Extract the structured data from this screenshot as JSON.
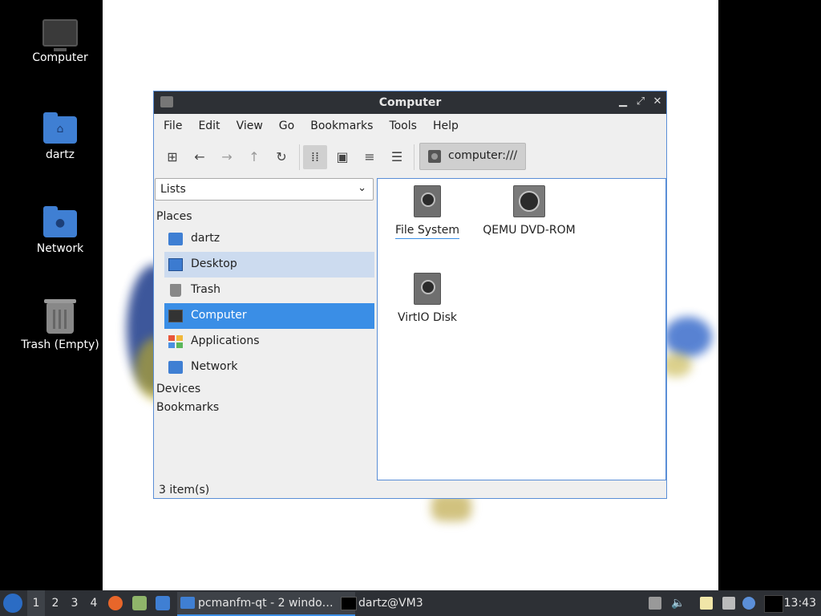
{
  "desktop": {
    "icons": [
      {
        "label": "Computer",
        "icon": "monitor-icon"
      },
      {
        "label": "dartz",
        "icon": "home-folder-icon"
      },
      {
        "label": "Network",
        "icon": "network-folder-icon"
      },
      {
        "label": "Trash (Empty)",
        "icon": "trash-icon"
      }
    ]
  },
  "window": {
    "title": "Computer",
    "menu": [
      "File",
      "Edit",
      "View",
      "Go",
      "Bookmarks",
      "Tools",
      "Help"
    ],
    "toolbar": {
      "buttons": [
        "new-tab-icon",
        "back-arrow-icon",
        "forward-arrow-icon",
        "up-arrow-icon",
        "reload-icon",
        "icon-view-icon",
        "thumbnail-view-icon",
        "compact-view-icon",
        "detailed-list-icon"
      ],
      "path": "computer:///"
    },
    "side": {
      "mode": "Lists",
      "places_label": "Places",
      "places": [
        {
          "label": "dartz",
          "icon": "home-folder-icon"
        },
        {
          "label": "Desktop",
          "icon": "desktop-icon"
        },
        {
          "label": "Trash",
          "icon": "trash-icon"
        },
        {
          "label": "Computer",
          "icon": "computer-icon"
        },
        {
          "label": "Applications",
          "icon": "applications-icon"
        },
        {
          "label": "Network",
          "icon": "network-folder-icon"
        }
      ],
      "devices_label": "Devices",
      "bookmarks_label": "Bookmarks"
    },
    "items": [
      {
        "label": "File System",
        "icon": "hard-disk-icon"
      },
      {
        "label": "QEMU DVD-ROM",
        "icon": "optical-drive-icon"
      },
      {
        "label": "VirtIO Disk",
        "icon": "hard-disk-icon"
      }
    ],
    "status": "3 item(s)"
  },
  "taskbar": {
    "workspaces": [
      "1",
      "2",
      "3",
      "4"
    ],
    "tasks": [
      {
        "label": "pcmanfm-qt - 2 windo…"
      },
      {
        "label": "dartz@VM3"
      }
    ],
    "clock": "13:43"
  },
  "colors": {
    "accent": "#3a8ee6",
    "titlebar": "#2d3035",
    "hover": "#ccdbef"
  }
}
